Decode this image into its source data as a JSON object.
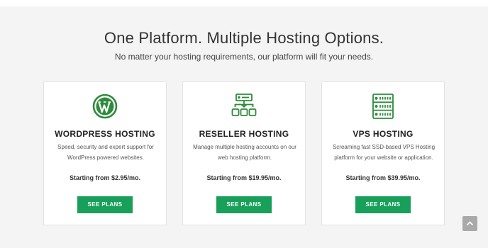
{
  "section": {
    "title": "One Platform. Multiple Hosting Options.",
    "subtitle": "No matter your hosting requirements, our platform will fit your needs."
  },
  "plans": [
    {
      "icon": "wordpress-icon",
      "title": "WORDPRESS HOSTING",
      "description": "Speed, security and expert support for WordPress powered websites.",
      "price": "Starting from $2.95/mo.",
      "button": "SEE PLANS"
    },
    {
      "icon": "reseller-network-icon",
      "title": "RESELLER HOSTING",
      "description": "Manage multiple hosting accounts on our web hosting platform.",
      "price": "Starting from $19.95/mo.",
      "button": "SEE PLANS"
    },
    {
      "icon": "server-stack-icon",
      "title": "VPS HOSTING",
      "description": "Screaming fast SSD-based VPS Hosting platform for your website or application.",
      "price": "Starting from $39.95/mo.",
      "button": "SEE PLANS"
    }
  ],
  "scroll_top": {
    "icon": "chevron-up-icon"
  },
  "colors": {
    "accent": "#18a05a",
    "icon_green": "#2e8b3c",
    "background": "#f4f4f4",
    "card": "#ffffff"
  }
}
